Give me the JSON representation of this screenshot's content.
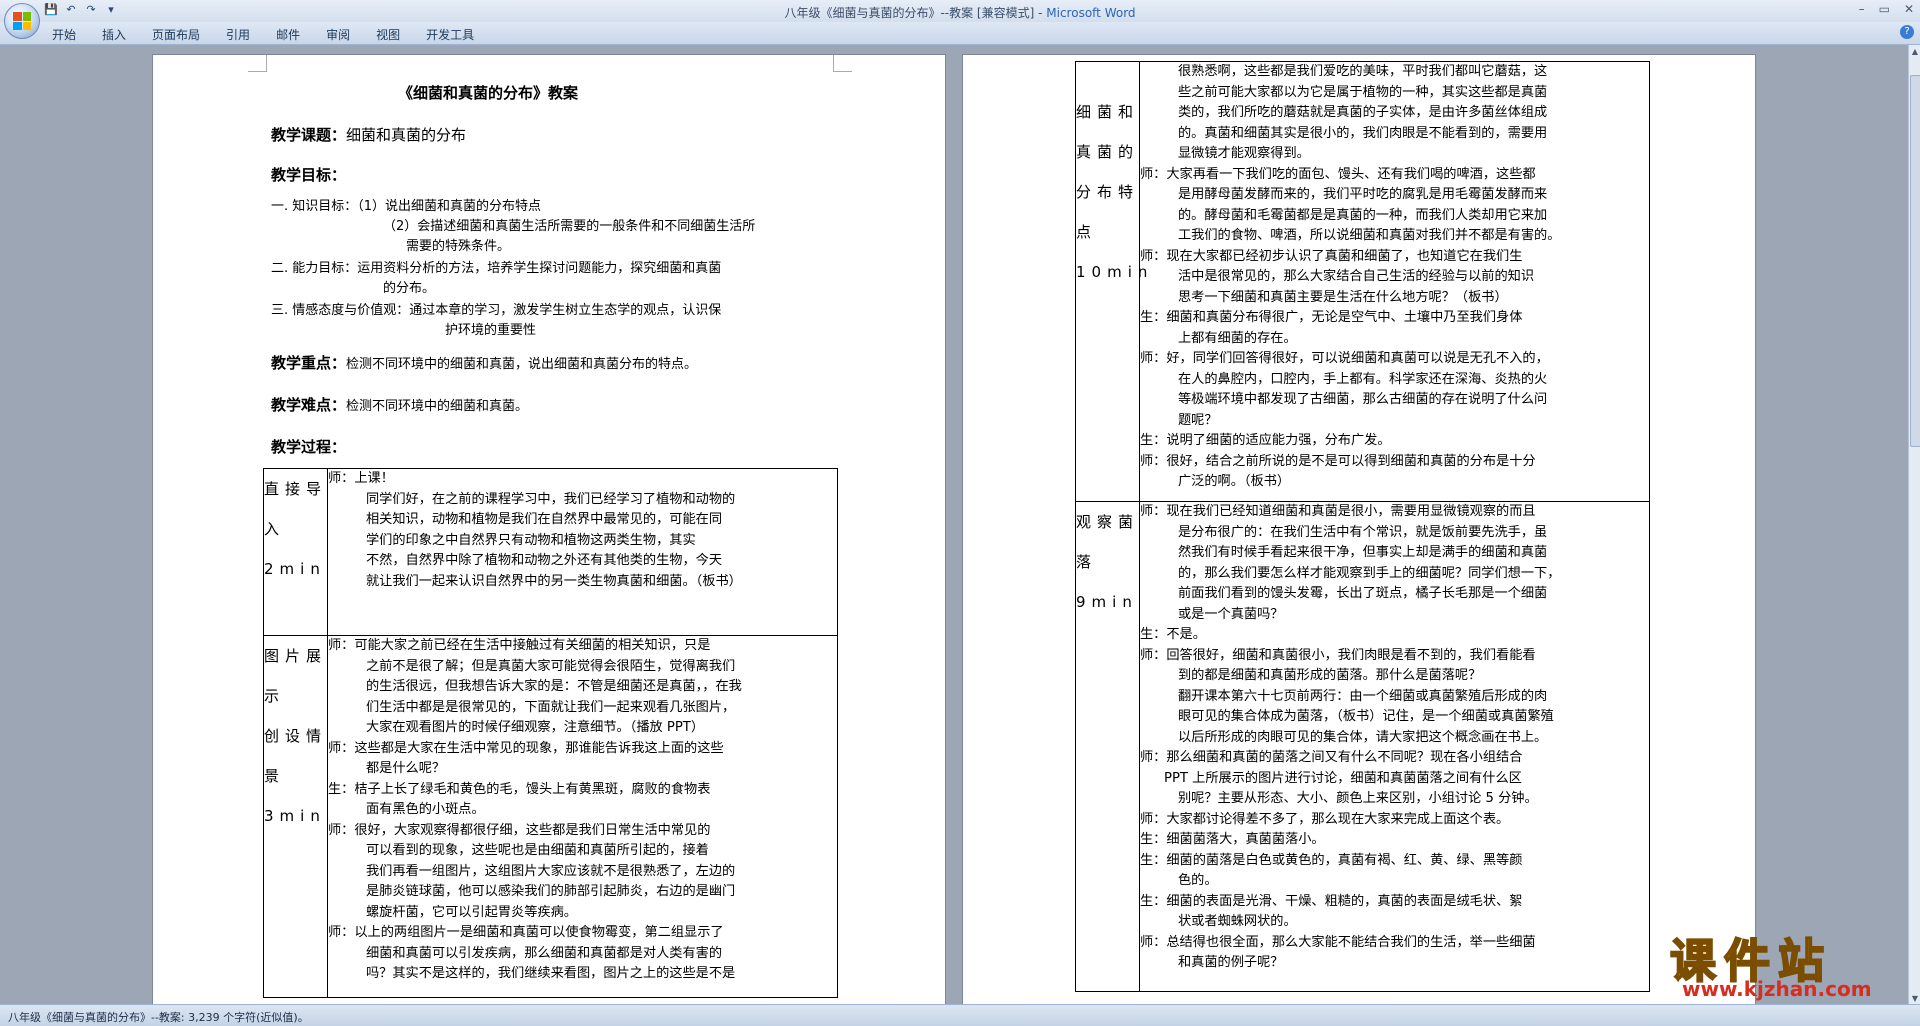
{
  "window": {
    "title_doc": "八年级《细菌与真菌的分布》--教案 [兼容模式] - ",
    "title_app": "Microsoft Word",
    "controls": [
      "–",
      "▭",
      "✕"
    ]
  },
  "qat": {
    "save": "💾",
    "undo": "↶",
    "redo": "↷",
    "more": "▾"
  },
  "ribbon": {
    "tabs": [
      "开始",
      "插入",
      "页面布局",
      "引用",
      "邮件",
      "审阅",
      "视图",
      "开发工具"
    ],
    "help": "?"
  },
  "page1": {
    "title": "《细菌和真菌的分布》教案",
    "topic_label": "教学课题：",
    "topic": "细菌和真菌的分布",
    "goals_label": "教学目标：",
    "goals": [
      "一. 知识目标：（1）说出细菌和真菌的分布特点",
      "（2）会描述细菌和真菌生活所需要的一般条件和不同细菌生活所",
      "需要的特殊条件。",
      "二. 能力目标：运用资料分析的方法，培养学生探讨问题能力，探究细菌和真菌",
      "的分布。",
      "三. 情感态度与价值观：通过本章的学习，激发学生树立生态学的观点，认识保",
      "护环境的重要性"
    ],
    "key_label": "教学重点：",
    "key": "检测不同环境中的细菌和真菌，说出细菌和真菌分布的特点。",
    "diff_label": "教学难点：",
    "diff": "检测不同环境中的细菌和真菌。",
    "process_label": "教学过程：",
    "rows": [
      {
        "seg": [
          "直接导",
          "入",
          "2min"
        ],
        "lines": [
          "师：上课！",
          "同学们好，在之前的课程学习中，我们已经学习了植物和动物的",
          "相关知识，动物和植物是我们在自然界中最常见的，可能在同",
          "学们的印象之中自然界只有动物和植物这两类生物，其实",
          "不然，自然界中除了植物和动物之外还有其他类的生物，今天",
          "就让我们一起来认识自然界中的另一类生物真菌和细菌。（板书）"
        ]
      },
      {
        "seg": [
          "图片展",
          "示",
          "创设情",
          "景",
          "3min"
        ],
        "lines": [
          "师：可能大家之前已经在生活中接触过有关细菌的相关知识，只是",
          "之前不是很了解；但是真菌大家可能觉得会很陌生，觉得离我们",
          "的生活很远，但我想告诉大家的是：不管是细菌还是真菌，，在我",
          "们生活中都是是很常见的，下面就让我们一起来观看几张图片，",
          "大家在观看图片的时候仔细观察，注意细节。（播放 PPT）",
          "师：这些都是大家在生活中常见的现象，那谁能告诉我这上面的这些",
          "都是什么呢？",
          "生：桔子上长了绿毛和黄色的毛，馒头上有黄黑斑，腐败的食物表",
          "面有黑色的小斑点。",
          "师：很好，大家观察得都很仔细，这些都是我们日常生活中常见的",
          "可以看到的现象，这些呢也是由细菌和真菌所引起的，接着",
          "我们再看一组图片，这组图片大家应该就不是很熟悉了，左边的",
          "是肺炎链球菌，他可以感染我们的肺部引起肺炎，右边的是幽门",
          "螺旋杆菌，它可以引起胃炎等疾病。",
          "师：以上的两组图片一是细菌和真菌可以使食物霉变，第二组显示了",
          "细菌和真菌可以引发疾病，那么细菌和真菌都是对人类有害的",
          "吗？其实不是这样的，我们继续来看图，图片之上的这些是不是"
        ]
      }
    ]
  },
  "page2": {
    "rows": [
      {
        "seg": [
          "细菌和",
          "真菌的",
          "分布特",
          "点",
          "10min"
        ],
        "lines": [
          "很熟悉啊，这些都是我们爱吃的美味，平时我们都叫它蘑菇，这",
          "些之前可能大家都以为它是属于植物的一种，其实这些都是真菌",
          "类的，我们所吃的蘑菇就是真菌的子实体，是由许多菌丝体组成",
          "的。真菌和细菌其实是很小的，我们肉眼是不能看到的，需要用",
          "显微镜才能观察得到。",
          "师：大家再看一下我们吃的面包、馒头、还有我们喝的啤酒，这些都",
          "是用酵母菌发酵而来的，我们平时吃的腐乳是用毛霉菌发酵而来",
          "的。酵母菌和毛霉菌都是是真菌的一种，而我们人类却用它来加",
          "工我们的食物、啤酒，所以说细菌和真菌对我们并不都是有害的。",
          "师：现在大家都已经初步认识了真菌和细菌了，也知道它在我们生",
          "活中是很常见的，那么大家结合自己生活的经验与以前的知识",
          "思考一下细菌和真菌主要是生活在什么地方呢？（板书）",
          "生：细菌和真菌分布得很广，无论是空气中、土壤中乃至我们身体",
          "上都有细菌的存在。",
          "师：好，同学们回答得很好，可以说细菌和真菌可以说是无孔不入的，",
          "在人的鼻腔内，口腔内，手上都有。科学家还在深海、炎热的火",
          "等极端环境中都发现了古细菌，那么古细菌的存在说明了什么问",
          "题呢？",
          "生：说明了细菌的适应能力强，分布广发。",
          "师：很好，结合之前所说的是不是可以得到细菌和真菌的分布是十分",
          "广泛的啊。（板书）"
        ]
      },
      {
        "seg": [
          "观察菌",
          "落 9min"
        ],
        "lines": [
          "师：现在我们已经知道细菌和真菌是很小，需要用显微镜观察的而且",
          "是分布很广的：在我们生活中有个常识，就是饭前要先洗手，虽",
          "然我们有时候手看起来很干净，但事实上却是满手的细菌和真菌",
          "的，那么我们要怎么样才能观察到手上的细菌呢？同学们想一下，",
          "前面我们看到的馒头发霉，长出了斑点，橘子长毛那是一个细菌",
          "或是一个真菌吗？",
          "生：不是。",
          "师：回答很好，细菌和真菌很小，我们肉眼是看不到的，我们看能看",
          "到的都是细菌和真菌形成的菌落。那什么是菌落呢？",
          "翻开课本第六十七页前两行：由一个细菌或真菌繁殖后形成的肉",
          "眼可见的集合体成为菌落，（板书）记住，是一个细菌或真菌繁殖",
          "以后所形成的肉眼可见的集合体，请大家把这个概念画在书上。",
          "师：那么细菌和真菌的菌落之间又有什么不同呢？现在各小组结合",
          "PPT 上所展示的图片进行讨论，细菌和真菌菌落之间有什么区",
          "别呢？主要从形态、大小、颜色上来区别，小组讨论 5 分钟。",
          "师：大家都讨论得差不多了，那么现在大家来完成上面这个表。",
          "生：细菌菌落大，真菌菌落小。",
          "生：细菌的菌落是白色或黄色的，真菌有褐、红、黄、绿、黑等颜",
          "色的。",
          "生：细菌的表面是光滑、干燥、粗糙的，真菌的表面是绒毛状、絮",
          "状或者蜘蛛网状的。",
          "师：总结得也很全面，那么大家能不能结合我们的生活，举一些细菌",
          "和真菌的例子呢？"
        ]
      }
    ]
  },
  "status": "八年级《细菌与真菌的分布》--教案: 3,239 个字符(近似值)。",
  "watermark": {
    "cn": "课件站",
    "url": "www.kjzhan.com"
  }
}
